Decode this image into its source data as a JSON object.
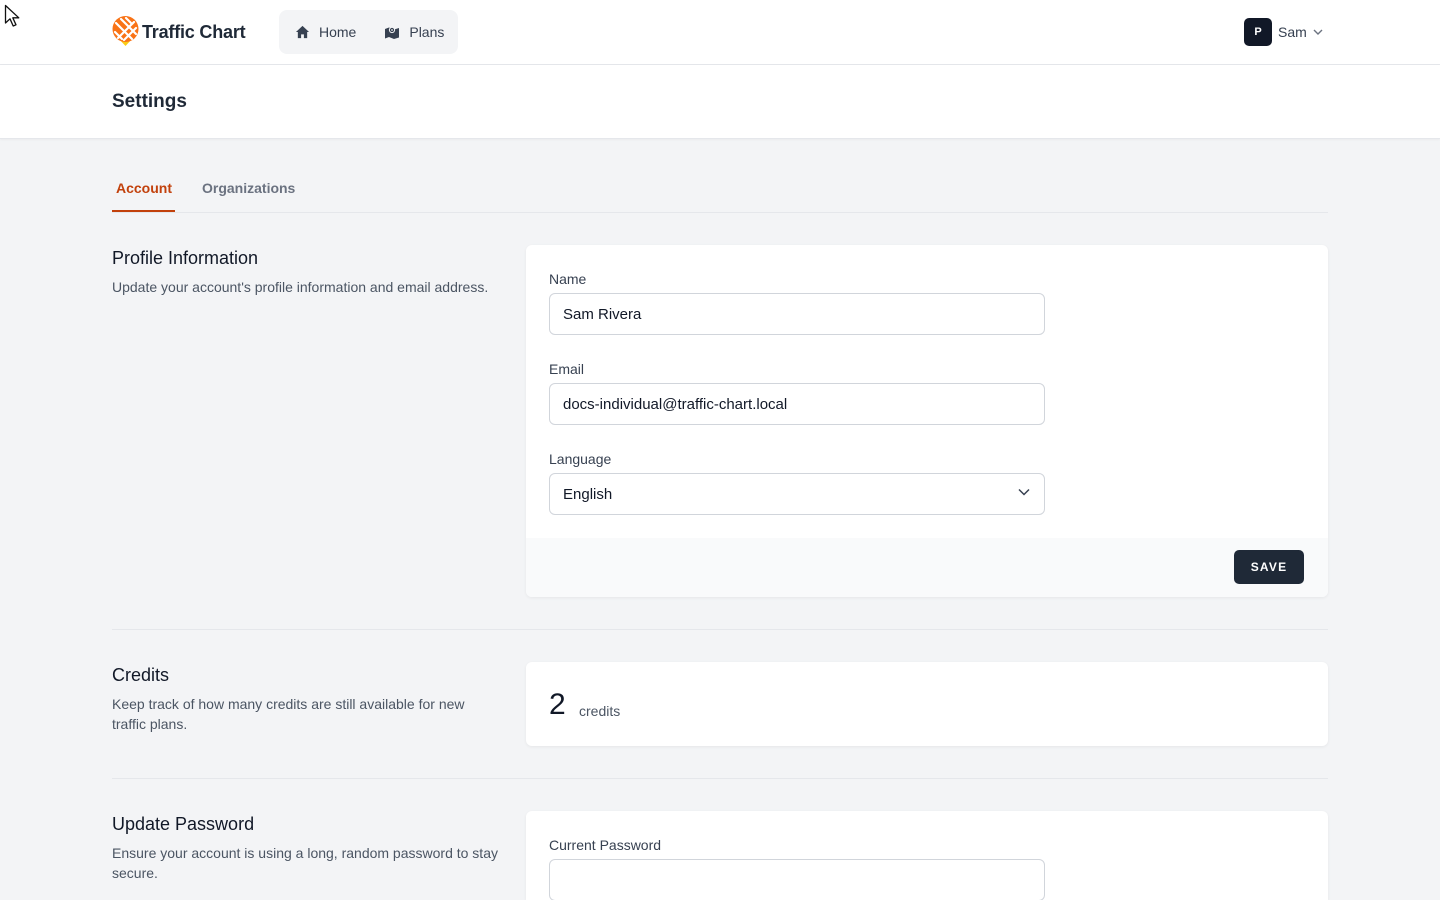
{
  "brand": {
    "name": "Traffic Chart",
    "accent": "#c2410c",
    "logo_colors": [
      "#f97316",
      "#facc15"
    ]
  },
  "nav": {
    "items": [
      {
        "label": "Home",
        "icon": "home-icon"
      },
      {
        "label": "Plans",
        "icon": "map-icon"
      }
    ]
  },
  "user": {
    "avatar_initial": "P",
    "name": "Sam"
  },
  "page": {
    "title": "Settings"
  },
  "tabs": [
    {
      "label": "Account",
      "active": true
    },
    {
      "label": "Organizations",
      "active": false
    }
  ],
  "profile": {
    "title": "Profile Information",
    "description": "Update your account's profile information and email address.",
    "name_label": "Name",
    "name_value": "Sam Rivera",
    "email_label": "Email",
    "email_value": "docs-individual@traffic-chart.local",
    "language_label": "Language",
    "language_value": "English",
    "save_label": "SAVE"
  },
  "credits": {
    "title": "Credits",
    "description": "Keep track of how many credits are still available for new traffic plans.",
    "count": "2",
    "unit": "credits"
  },
  "password": {
    "title": "Update Password",
    "description": "Ensure your account is using a long, random password to stay secure.",
    "current_label": "Current Password",
    "current_value": ""
  }
}
